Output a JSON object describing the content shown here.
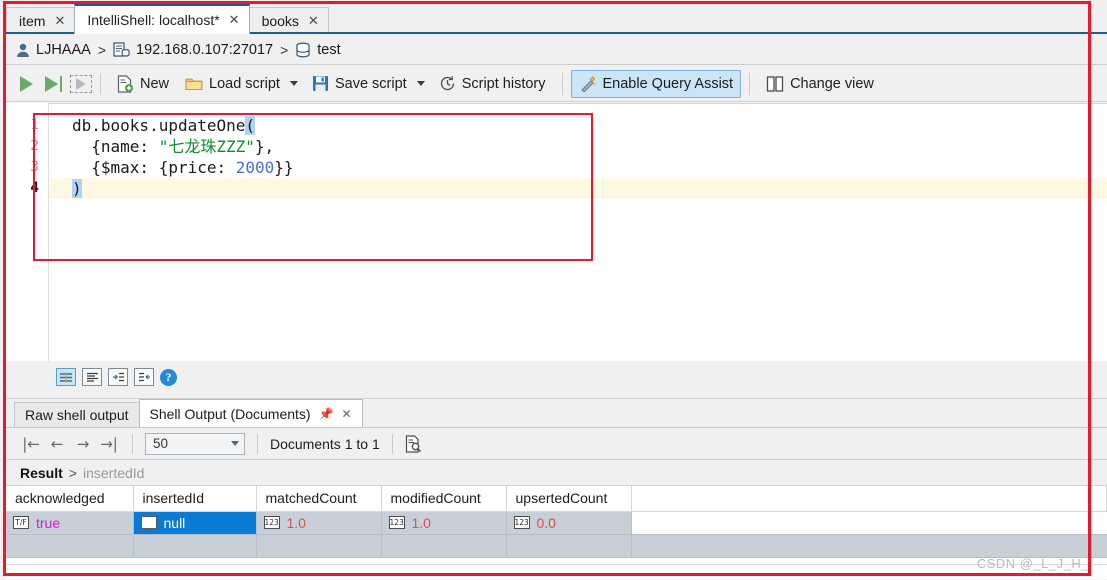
{
  "window": {
    "tabs": [
      {
        "label": "item",
        "active": false,
        "close_icon": "close-icon"
      },
      {
        "label": "IntelliShell: localhost*",
        "active": true,
        "close_icon": "close-icon"
      },
      {
        "label": "books",
        "active": false,
        "close_icon": "close-icon"
      }
    ]
  },
  "breadcrumb": {
    "user": "LJHAAA",
    "sep1": ">",
    "server": "192.168.0.107:27017",
    "sep2": ">",
    "database": "test",
    "icons": {
      "user": "user-icon",
      "server": "server-icon",
      "database": "database-icon"
    }
  },
  "toolbar": {
    "run_icon": "run-icon",
    "run_selection_icon": "run-selection-icon",
    "run_disabled_icon": "run-disabled-icon",
    "new_label": "New",
    "load_script_label": "Load script",
    "save_script_label": "Save script",
    "script_history_label": "Script history",
    "enable_query_assist_label": "Enable Query Assist",
    "change_view_label": "Change view",
    "icons": {
      "new": "new-document-icon",
      "load": "folder-icon",
      "save": "floppy-disk-icon",
      "history": "history-clock-icon",
      "query_assist": "magic-wand-icon",
      "change_view": "split-columns-icon"
    }
  },
  "editor": {
    "lines": [
      {
        "num": "1",
        "active": false
      },
      {
        "num": "2",
        "active": false
      },
      {
        "num": "3",
        "active": false
      },
      {
        "num": "4",
        "active": true
      }
    ],
    "code": {
      "l1_a": "db.books.updateOne",
      "l1_paren": "(",
      "l2_a": "  {name: ",
      "l2_str": "\"七龙珠ZZZ\"",
      "l2_b": "},",
      "l3_a": "  {$max: {price: ",
      "l3_num": "2000",
      "l3_b": "}}",
      "l4_paren": ")"
    }
  },
  "editor_icons": [
    {
      "name": "format-script-icon",
      "glyph": "≋",
      "selected": true
    },
    {
      "name": "align-left-icon",
      "glyph": "≡",
      "selected": false
    },
    {
      "name": "indent-right-icon",
      "glyph": "→",
      "selected": false
    },
    {
      "name": "indent-left-icon",
      "glyph": "←",
      "selected": false
    },
    {
      "name": "help-icon",
      "glyph": "?",
      "selected": false
    }
  ],
  "results": {
    "tabs": [
      {
        "label": "Raw shell output",
        "active": false
      },
      {
        "label": "Shell Output (Documents)",
        "active": true,
        "pin_icon": "pin-icon",
        "close_icon": "close-icon"
      }
    ],
    "nav": {
      "first_icon": "first-page-icon",
      "prev_icon": "previous-page-icon",
      "next_icon": "next-page-icon",
      "last_icon": "last-page-icon"
    },
    "page_size": "50",
    "document_count_label": "Documents 1 to 1",
    "find_icon": "find-document-icon",
    "crumb": {
      "root": "Result",
      "sep": ">",
      "field": "insertedId"
    },
    "table": {
      "columns": [
        "acknowledged",
        "insertedId",
        "matchedCount",
        "modifiedCount",
        "upsertedCount"
      ],
      "rows": [
        [
          {
            "type_icon": "T/F",
            "value": "true",
            "kind": "bool"
          },
          {
            "type_icon": "",
            "value": "null",
            "kind": "null",
            "selected": true
          },
          {
            "type_icon": "123",
            "value": "1.0",
            "kind": "num"
          },
          {
            "type_icon": "123",
            "value": "1.0",
            "kind": "num"
          },
          {
            "type_icon": "123",
            "value": "0.0",
            "kind": "num"
          }
        ]
      ]
    }
  },
  "watermark": "CSDN @_L_J_H_",
  "colors": {
    "accent_blue": "#1c5a9e",
    "annotation_red": "#e8192c",
    "selection_blue": "#0a7ad4",
    "row_grey_blue": "#c7cfd9",
    "string_green": "#138a2f",
    "number_blue": "#4a6fd6",
    "bool_magenta": "#d41fc0",
    "num_red": "#e0504a",
    "current_line": "#fdf8e3"
  }
}
